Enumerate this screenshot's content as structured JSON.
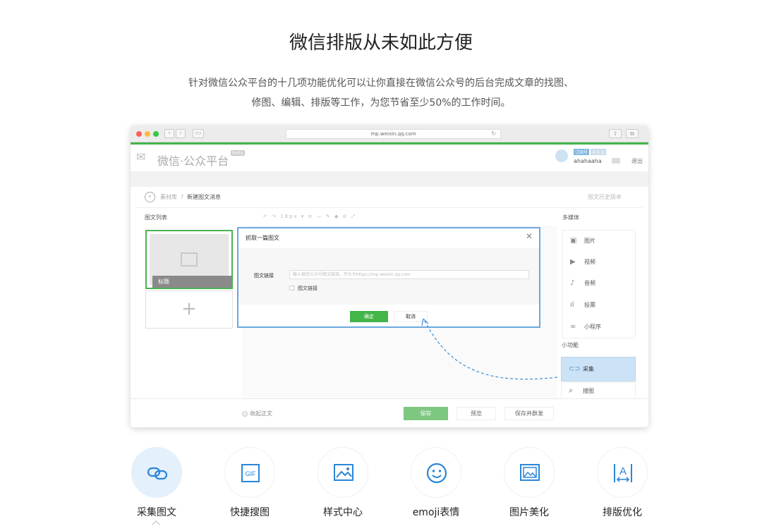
{
  "hero": {
    "title": "微信排版从未如此方便",
    "desc_line1": "针对微信公众平台的十几项功能优化可以让你直接在微信公众号的后台完成文章的找图、",
    "desc_line2": "修图、编辑、排版等工作，为您节省至少50%的工作时间。"
  },
  "browser": {
    "url": "mp.weixin.qq.com",
    "back": "‹",
    "forward": "›"
  },
  "wx": {
    "brand": "微信·公众平台",
    "beta": "beta",
    "user_tag1": "订阅号",
    "user_tag2": "未认证",
    "user_name": "ahahaaha",
    "logout": "退出"
  },
  "editor": {
    "breadcrumb_1": "素材库",
    "breadcrumb_sep": "/",
    "breadcrumb_2": "新建图文消息",
    "history": "图文历史版本",
    "article_list_title": "图文列表",
    "thumb_caption": "标题",
    "add_symbol": "+",
    "toolbar": "↶ ↷  16px ▾  ≡  —  ✎  ◆  ⊘  ⤢",
    "media_title": "多媒体",
    "media_items": [
      "图片",
      "视频",
      "音频",
      "投票",
      "小程序"
    ],
    "small_func_title": "小功能",
    "collect_label": "采集",
    "search_label": "搜图"
  },
  "footer": {
    "collapse": "收起正文",
    "save": "保存",
    "preview": "预览",
    "save_send": "保存并群发"
  },
  "modal": {
    "title": "抓取一篇图文",
    "close": "✕",
    "field_label": "图文链接",
    "field_placeholder": "输入微信公众号图文链接，开头为https://mp.weixin.qq.com",
    "check_label": "图文链接",
    "ok": "确定",
    "cancel": "取消"
  },
  "features": [
    {
      "label": "采集图文",
      "icon": "link-icon",
      "active": true
    },
    {
      "label": "快捷搜图",
      "icon": "gif-icon",
      "active": false
    },
    {
      "label": "样式中心",
      "icon": "image-style-icon",
      "active": false
    },
    {
      "label": "emoji表情",
      "icon": "smile-icon",
      "active": false
    },
    {
      "label": "图片美化",
      "icon": "image-beautify-icon",
      "active": false
    },
    {
      "label": "排版优化",
      "icon": "layout-icon",
      "active": false
    }
  ],
  "colors": {
    "accent_blue": "#3a8fd9",
    "accent_green": "#44b549"
  }
}
